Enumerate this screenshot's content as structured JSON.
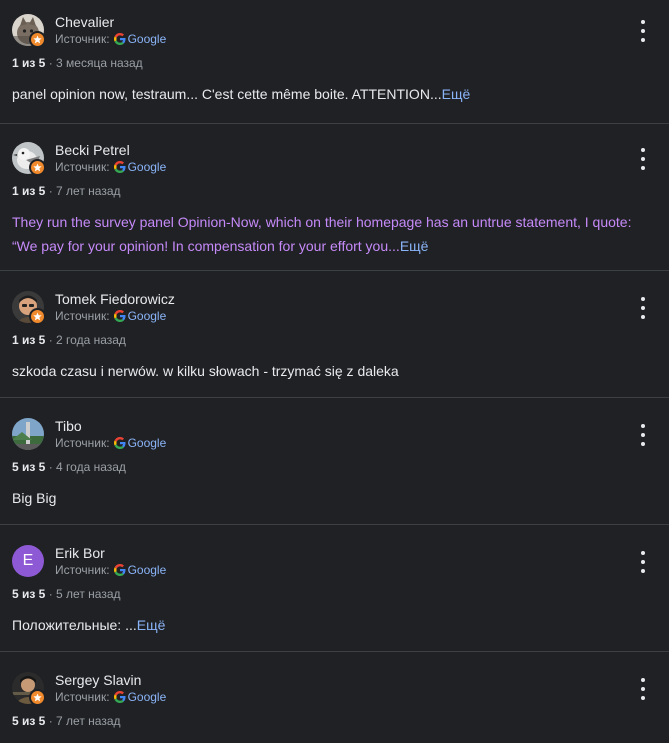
{
  "source_label": "Источник:",
  "source_name": "Google",
  "more_link": "Ещё",
  "reviews": [
    {
      "author": "Chevalier",
      "rating": "1 из 5",
      "ago": "· 3 месяца назад",
      "text": "panel opinion now, testraum... C'est cette même boite. ATTENTION",
      "ellipsis": "...",
      "avatar_icon": "cat-photo-avatar"
    },
    {
      "author": "Becki Petrel",
      "rating": "1 из 5",
      "ago": "· 7 лет назад",
      "text": "They run the survey panel Opinion-Now, which on their homepage has an untrue statement, I quote: “We pay for your opinion! In compensation for your effort you",
      "ellipsis": "...",
      "avatar_icon": "bird-photo-avatar"
    },
    {
      "author": "Tomek Fiedorowicz",
      "rating": "1 из 5",
      "ago": "· 2 года назад",
      "text": "szkoda czasu i nerwów. w kilku słowach - trzymać się z daleka",
      "avatar_icon": "person-photo-avatar"
    },
    {
      "author": "Tibo",
      "rating": "5 из 5",
      "ago": "· 4 года назад",
      "text": "Big Big",
      "avatar_icon": "landscape-photo-avatar"
    },
    {
      "author": "Erik Bor",
      "rating": "5 из 5",
      "ago": "· 5 лет назад",
      "text": "Положительные: ",
      "ellipsis": "...",
      "avatar_letter": "E",
      "avatar_color": "#8e59d4"
    },
    {
      "author": "Sergey Slavin",
      "rating": "5 из 5",
      "ago": "· 7 лет назад",
      "avatar_icon": "person-photo-avatar"
    }
  ],
  "colors": {
    "background": "#202124",
    "link": "#8ab4f8",
    "visited": "#c58af9",
    "badge": "#f08a2c"
  }
}
